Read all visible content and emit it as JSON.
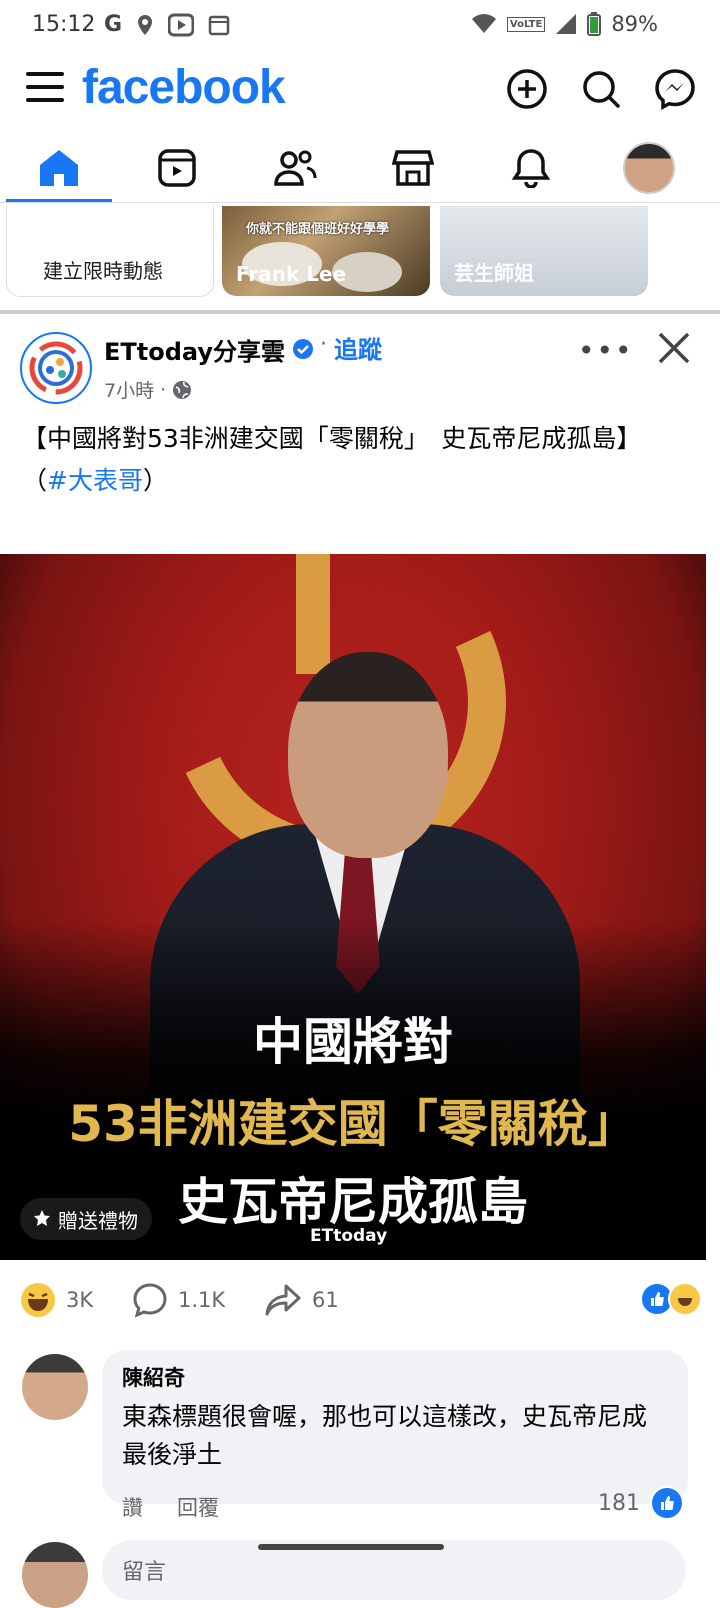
{
  "status_bar": {
    "time": "15:12",
    "battery": "89%",
    "network_badge": "VoLTE"
  },
  "app": {
    "logo": "facebook"
  },
  "header_actions": [
    "add-icon",
    "search-icon",
    "messenger-icon"
  ],
  "tabs": [
    "home-icon",
    "video-icon",
    "friends-icon",
    "marketplace-icon",
    "notifications-icon",
    "profile-avatar"
  ],
  "stories": {
    "create_label": "建立限時動態",
    "items": [
      {
        "name": "Frank Lee",
        "caption": "你就不能跟個班好好學學"
      },
      {
        "name": "芸生師姐"
      }
    ]
  },
  "post": {
    "page_name": "ETtoday分享雲",
    "follow_label": "追蹤",
    "time": "7小時",
    "separator": "·",
    "text_line": "【中國將對53非洲建交國「零關稅」　史瓦帝尼成孤島】",
    "text_prefix": "（",
    "hashtag": "#大表哥",
    "text_suffix": "）",
    "image": {
      "line1": "中國將對",
      "line2": "53非洲建交國「零關稅」",
      "line3": "史瓦帝尼成孤島",
      "brand": "ETtoday"
    },
    "gift_label": "贈送禮物",
    "reactions_count": "3K",
    "comments_count": "1.1K",
    "shares_count": "61"
  },
  "comment": {
    "author": "陳紹奇",
    "text": "東森標題很會喔，那也可以這樣改，史瓦帝尼成最後淨土",
    "like_label": "讚",
    "reply_label": "回覆",
    "likes": "181"
  },
  "comment_input": {
    "placeholder": "留言"
  },
  "colors": {
    "brand_blue": "#1877F2",
    "text_secondary": "#65676b",
    "image_accent": "#e0b84f"
  }
}
